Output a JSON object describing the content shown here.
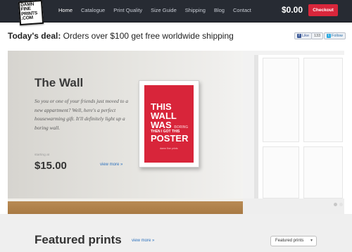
{
  "header": {
    "logo": {
      "line1": "DAMN",
      "line2": "FINE",
      "line3": "PRINTS",
      "line4": ".COM"
    },
    "nav": [
      {
        "label": "Home"
      },
      {
        "label": "Catalogue"
      },
      {
        "label": "Print Quality"
      },
      {
        "label": "Size Guide"
      },
      {
        "label": "Shipping"
      },
      {
        "label": "Blog"
      },
      {
        "label": "Contact"
      }
    ],
    "cart_total": "$0.00",
    "checkout_label": "Checkout"
  },
  "deal": {
    "prefix": "Today's deal:",
    "text": "Orders over $100 get free worldwide shipping"
  },
  "social": {
    "fb_like": "Like",
    "fb_count": "133",
    "tw_follow": "Follow"
  },
  "hero": {
    "title": "The Wall",
    "description": "So you or one of your friends just moved to a new appartment? Well, here's a perfect housewarming gift. It'll definitely light up a boring wall.",
    "price_caption": "starting at",
    "price": "$15.00",
    "view_more": "view more »",
    "poster": {
      "line1": "THIS WALL",
      "line2": "WAS",
      "line2b": "BORING",
      "line3": "THEN I GOT THIS",
      "line4": "POSTER",
      "signature": "damn fine prints"
    }
  },
  "featured": {
    "title": "Featured prints",
    "view_more": "view more »",
    "filter_selected": "Featured prints"
  },
  "colors": {
    "header_bg": "#272b33",
    "accent_red": "#d9263b",
    "link_blue": "#2d72bd"
  }
}
